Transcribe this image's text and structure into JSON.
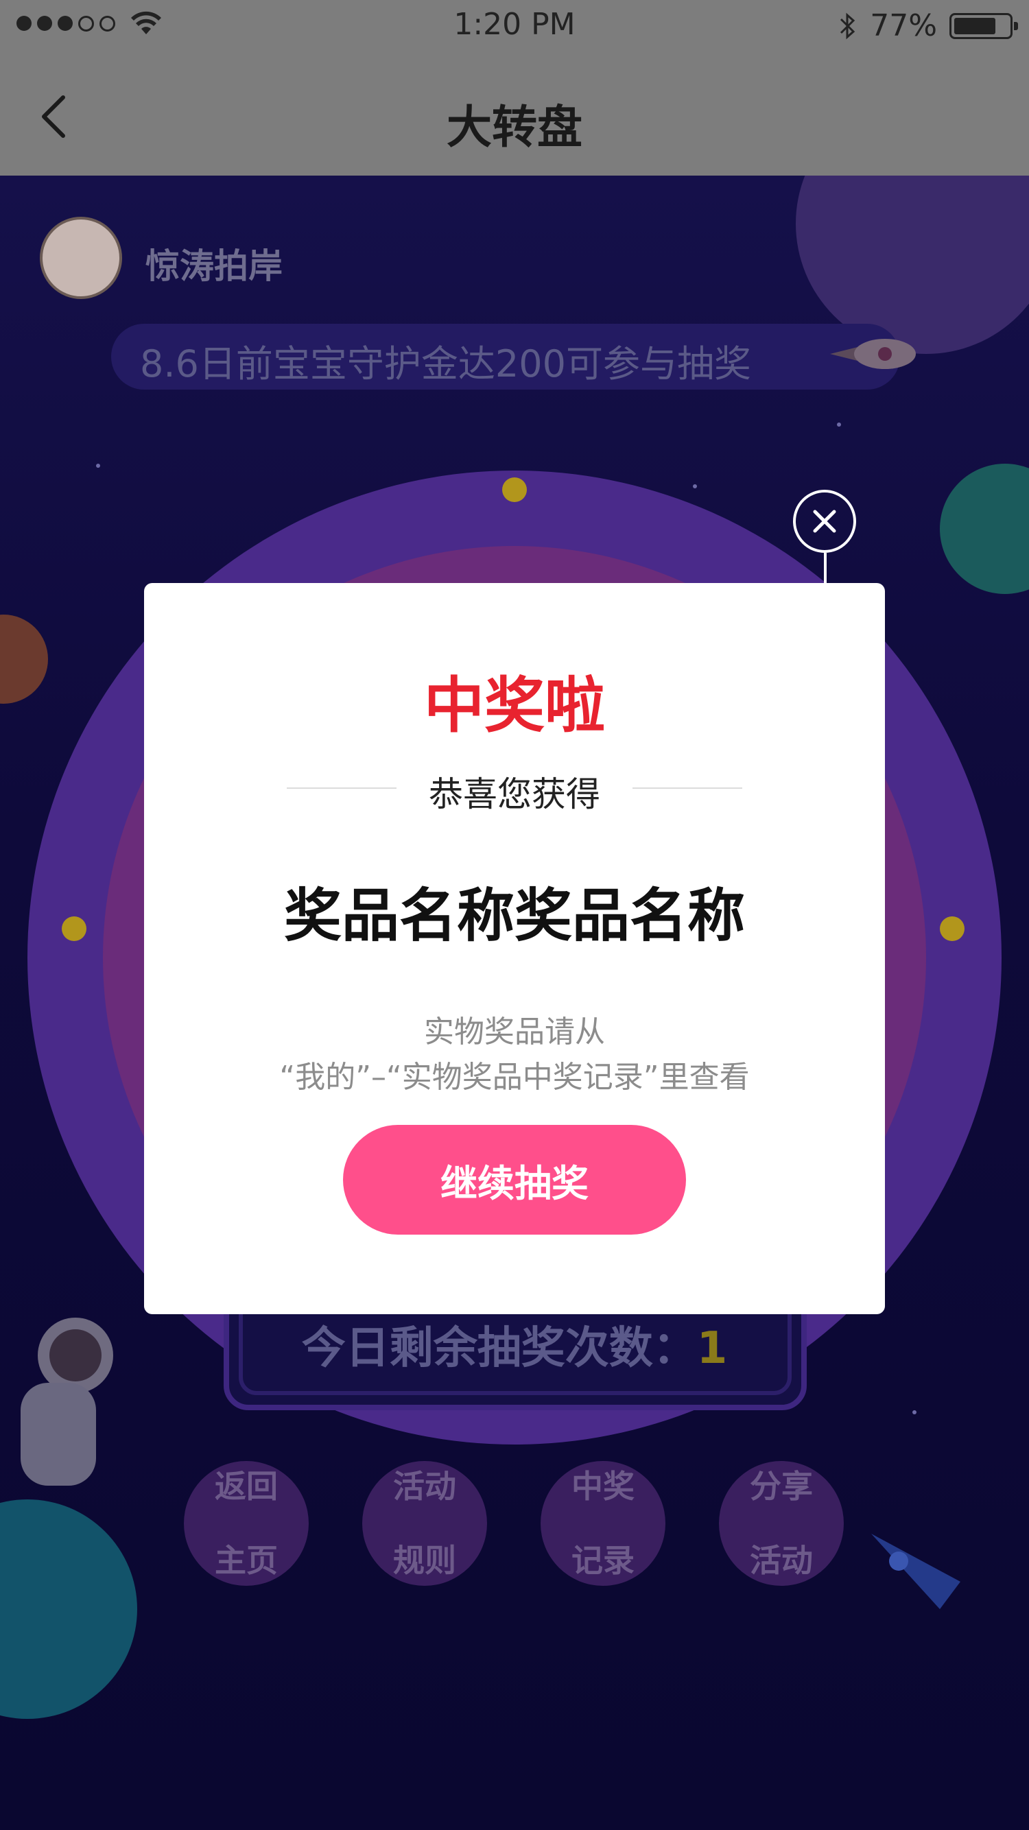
{
  "status_bar": {
    "time": "1:20 PM",
    "battery": "77%",
    "battery_level": 0.77,
    "signal_bars": 3
  },
  "nav": {
    "title": "大转盘"
  },
  "user": {
    "name": "惊涛拍岸"
  },
  "notice": {
    "text": "8.6日前宝宝守护金达200可参与抽奖"
  },
  "remaining": {
    "label": "今日剩余抽奖次数：",
    "count": "1"
  },
  "bottom_buttons": [
    {
      "line1": "返回",
      "line2": "主页"
    },
    {
      "line1": "活动",
      "line2": "规则"
    },
    {
      "line1": "中奖",
      "line2": "记录"
    },
    {
      "line1": "分享",
      "line2": "活动"
    }
  ],
  "modal": {
    "title": "中奖啦",
    "subtitle": "恭喜您获得",
    "prize_name": "奖品名称奖品名称",
    "hint_line1": "实物奖品请从",
    "hint_line2": "“我的”–“实物奖品中奖记录”里查看",
    "continue_label": "继续抽奖"
  },
  "colors": {
    "title_red": "#e8232f",
    "button_pink": "#ff4f8b"
  }
}
